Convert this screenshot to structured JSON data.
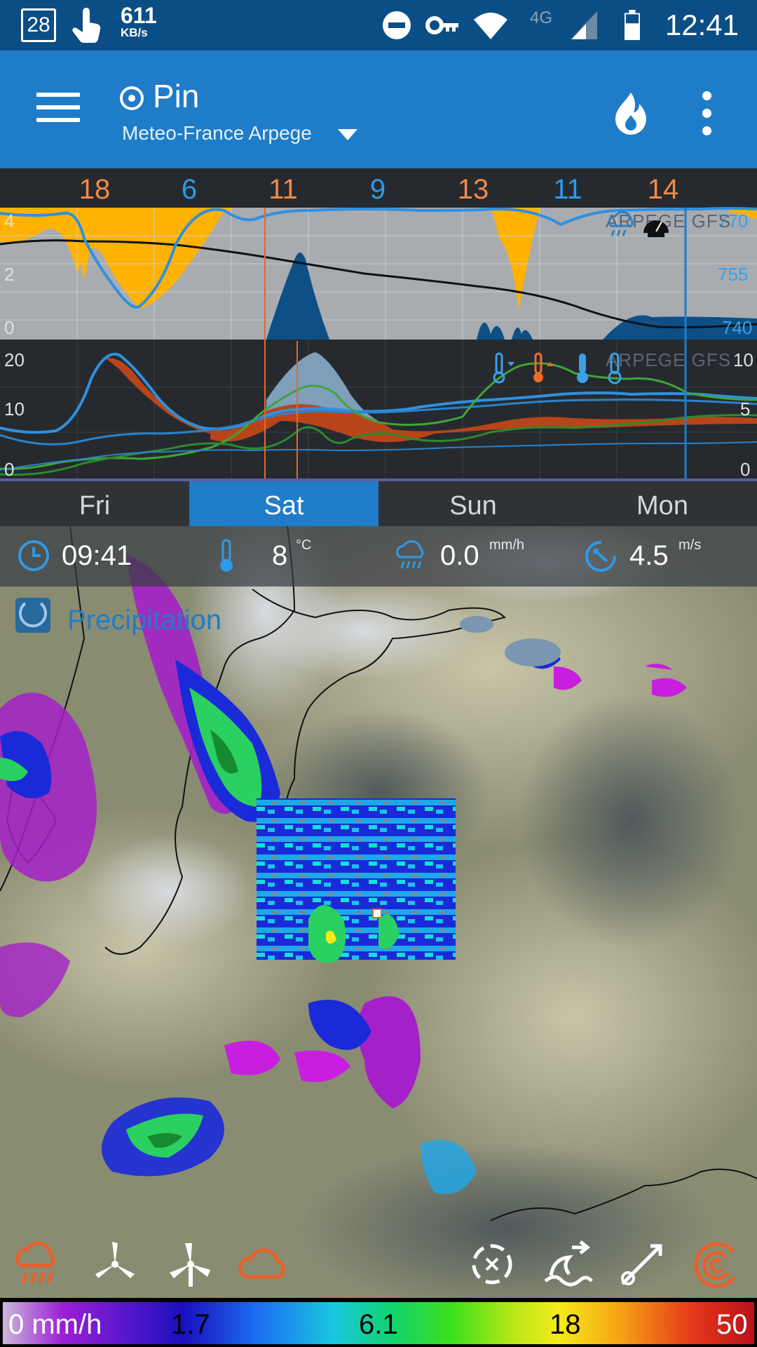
{
  "status_bar": {
    "date": "28",
    "net_speed": "611",
    "net_speed_unit": "KB/s",
    "network_type": "4G",
    "time": "12:41",
    "icons": [
      "calendar-icon",
      "touch-icon",
      "do-not-disturb-icon",
      "vpn-key-icon",
      "wifi-icon",
      "cell-signal-icon",
      "battery-icon"
    ]
  },
  "app_bar": {
    "title": "Pin",
    "subtitle": "Meteo-France Arpege",
    "icons": [
      "menu-icon",
      "pin-target-icon",
      "dropdown-arrow-icon",
      "flame-icon",
      "more-vert-icon"
    ]
  },
  "forecast": {
    "top_numbers": [
      {
        "value": "18",
        "tone": "hot"
      },
      {
        "value": "6",
        "tone": "cold"
      },
      {
        "value": "11",
        "tone": "hot"
      },
      {
        "value": "9",
        "tone": "cold"
      },
      {
        "value": "13",
        "tone": "hot"
      },
      {
        "value": "11",
        "tone": "cold"
      },
      {
        "value": "14",
        "tone": "hot"
      }
    ],
    "panel1": {
      "left_axis": [
        "4",
        "2",
        "0"
      ],
      "right_axis": [
        "770",
        "755",
        "740"
      ],
      "model_labels": "ARPEGE GFS"
    },
    "panel2": {
      "left_axis": [
        "20",
        "10",
        "0"
      ],
      "right_axis": [
        "10",
        "5",
        "0"
      ],
      "model_labels": "ARPEGE GFS"
    }
  },
  "days": [
    {
      "label": "Fri",
      "selected": false
    },
    {
      "label": "Sat",
      "selected": true
    },
    {
      "label": "Sun",
      "selected": false
    },
    {
      "label": "Mon",
      "selected": false
    }
  ],
  "map_info": {
    "time": "09:41",
    "temperature": "8",
    "temperature_unit": "°C",
    "precipitation": "0.0",
    "precipitation_unit": "mm/h",
    "wind": "4.5",
    "wind_unit": "m/s",
    "layer_title": "Precipitation"
  },
  "toolbar": {
    "tools": [
      "rain-layer-icon",
      "wind-turbine-icon",
      "wind-turbine-alt-icon",
      "cloud-icon",
      "wind-gust-icon",
      "wave-icon",
      "wind-barb-icon",
      "radar-icon"
    ]
  },
  "legend": {
    "unit_label": "0 mm/h",
    "stops": [
      "1.7",
      "6.1",
      "18",
      "50"
    ]
  },
  "colors": {
    "primary": "#1f7cc8",
    "status_bar": "#0b4e86",
    "hot": "#f08a4b",
    "cold": "#2f9ae8",
    "sunshine": "#ffb300",
    "chart_bg": "#262a2e"
  }
}
